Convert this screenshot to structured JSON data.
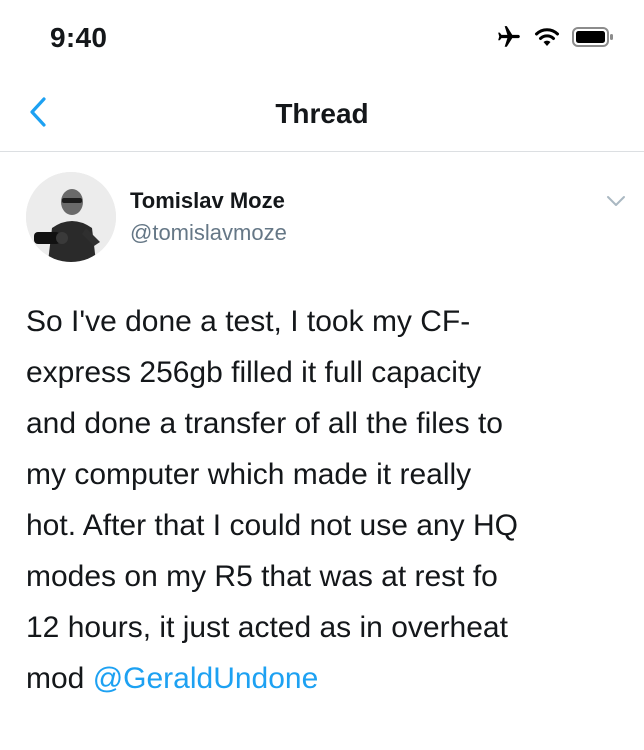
{
  "status_bar": {
    "time": "9:40",
    "icons": [
      "airplane-icon",
      "wifi-icon",
      "battery-icon"
    ]
  },
  "nav": {
    "back_icon": "chevron-left-icon",
    "title": "Thread"
  },
  "tweet": {
    "author": {
      "name": "Tomislav Moze",
      "handle": "@tomislavmoze"
    },
    "menu_icon": "chevron-down-icon",
    "body_lines": [
      "So I've done a test, I took my CF-",
      "express 256gb  filled it full capacity",
      "and done a transfer of all the files to",
      "my computer which made it really",
      "hot. After that I could not use any HQ",
      "modes on my R5 that was at rest fo",
      "12 hours, it just acted as in overheat"
    ],
    "last_line_text": "mod ",
    "mention": "@GeraldUndone"
  },
  "colors": {
    "accent": "#1da1f2",
    "text": "#14171a",
    "secondary_text": "#657786",
    "divider": "#dcdfe2"
  }
}
